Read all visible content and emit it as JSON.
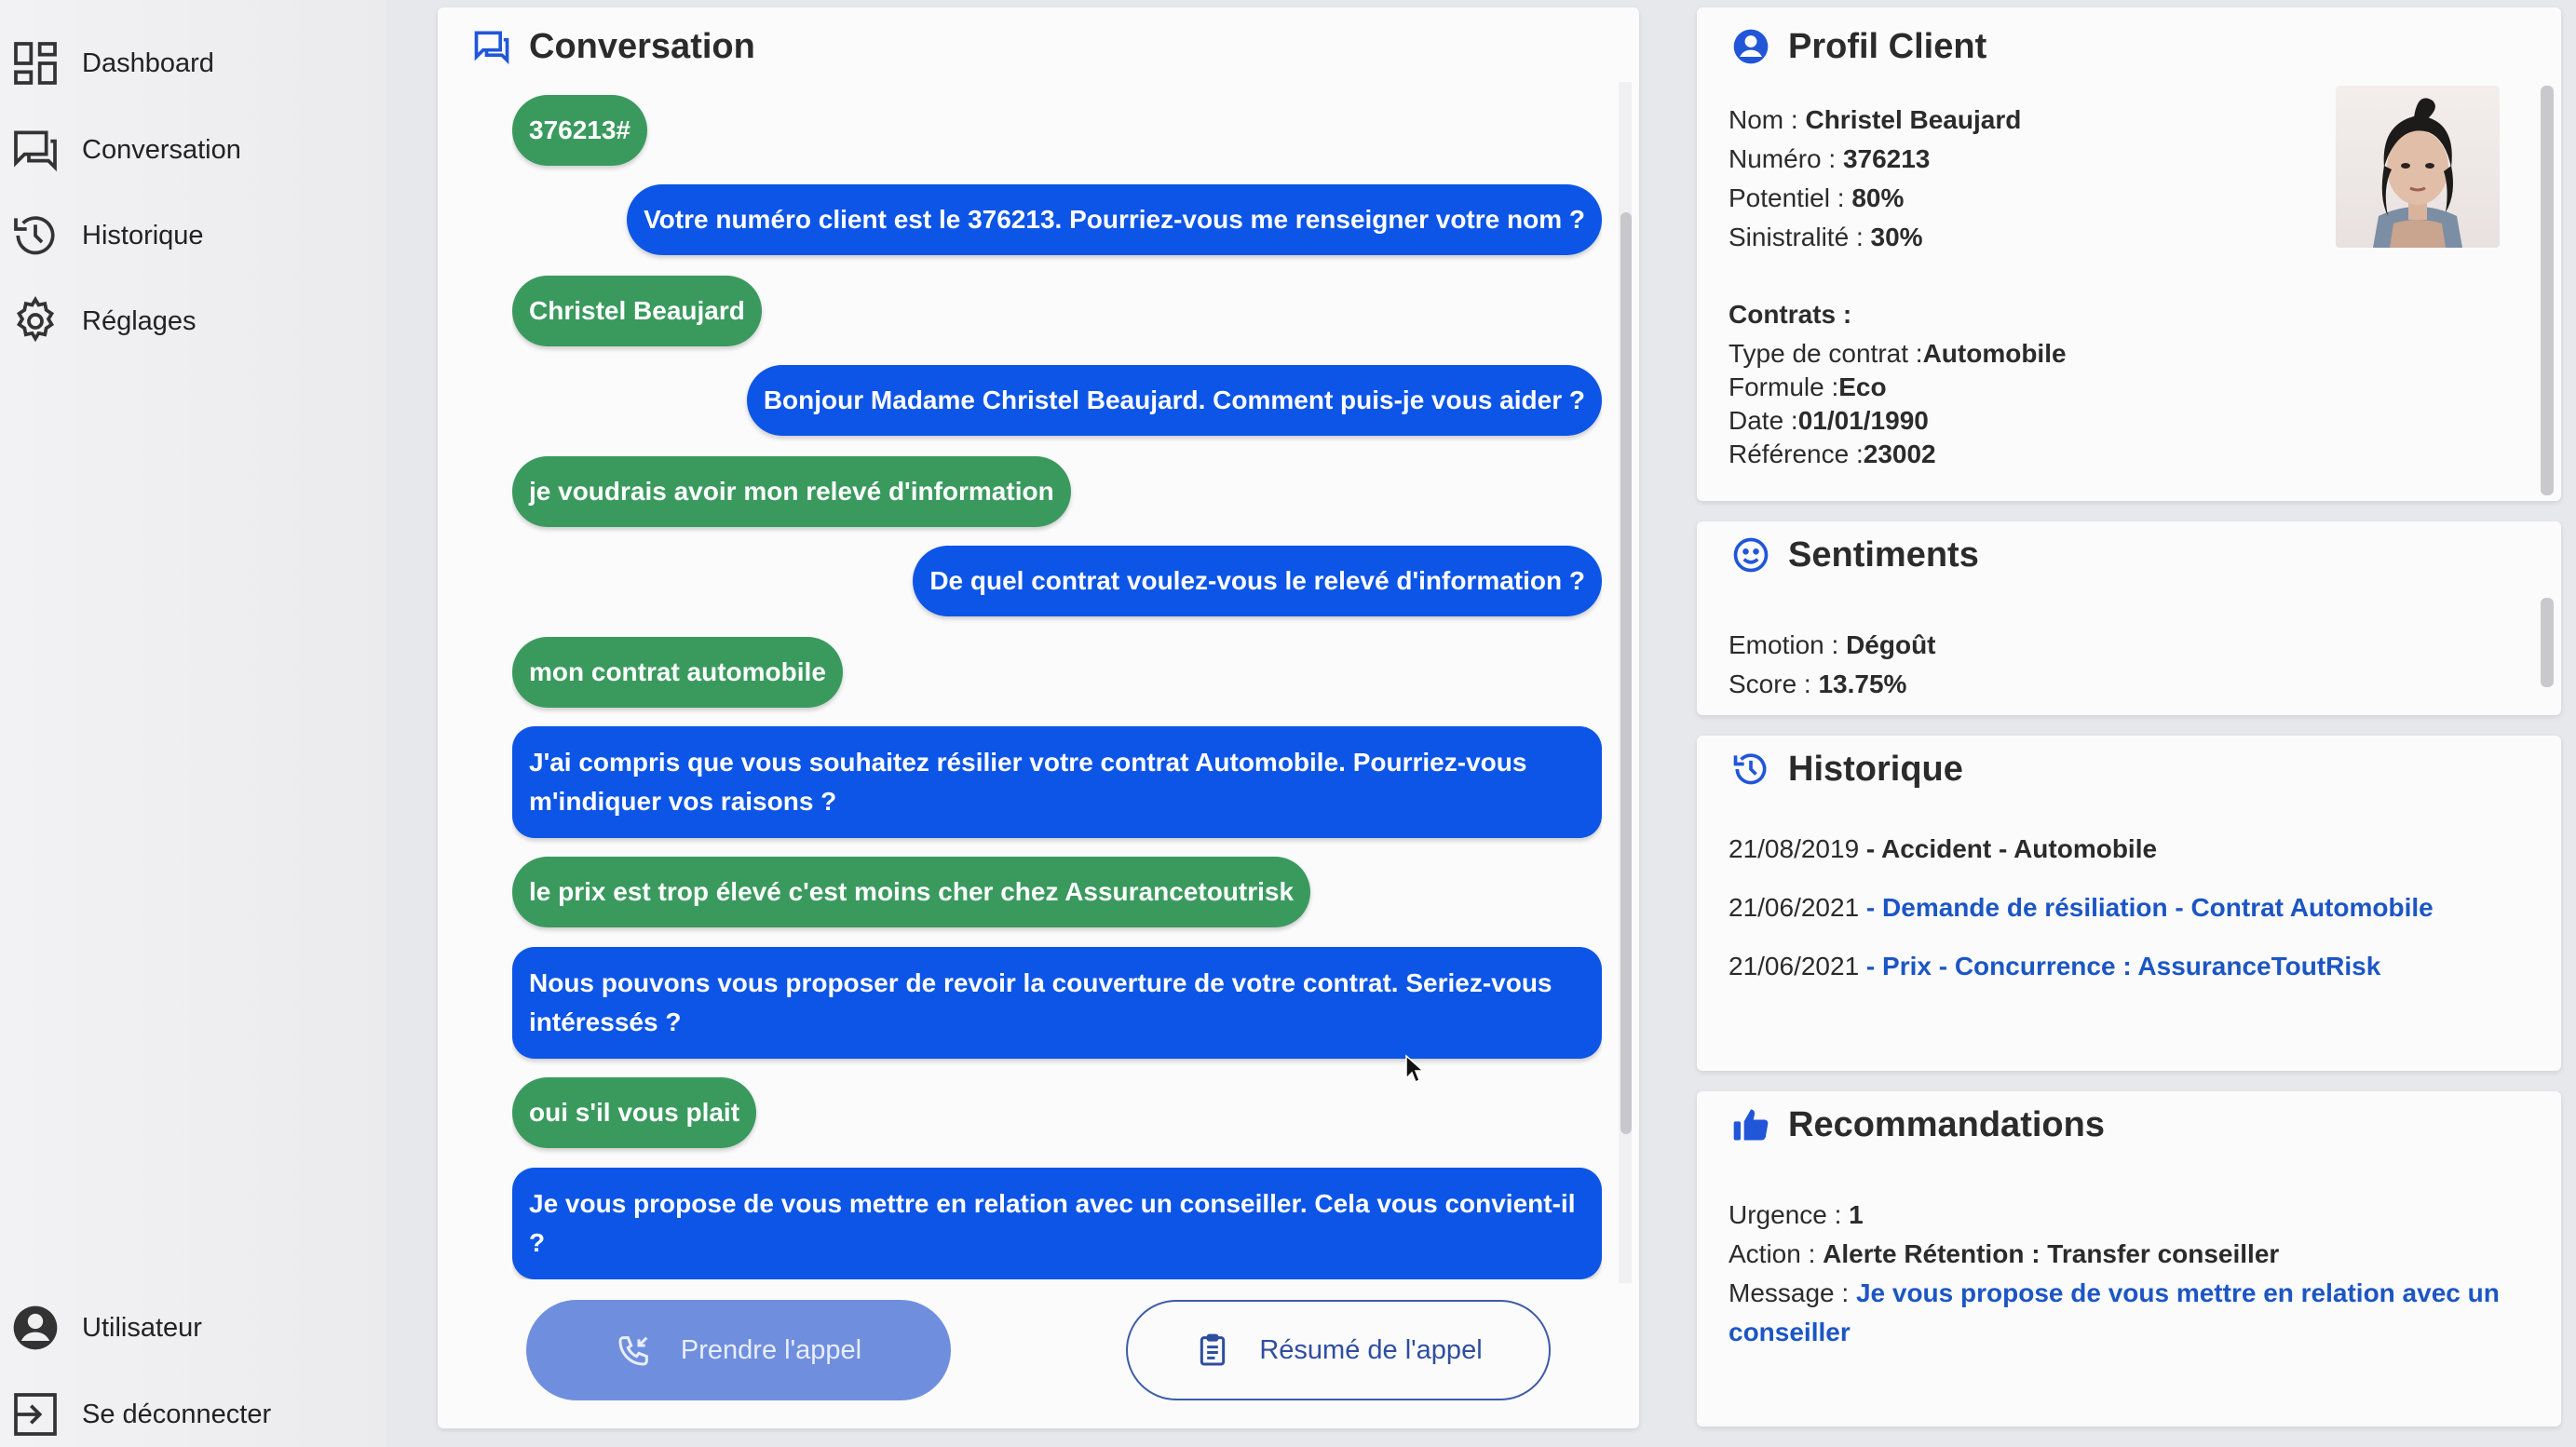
{
  "sidebar": {
    "items": [
      {
        "label": "Dashboard",
        "icon": "dashboard-icon"
      },
      {
        "label": "Conversation",
        "icon": "chat-icon"
      },
      {
        "label": "Historique",
        "icon": "history-icon"
      },
      {
        "label": "Réglages",
        "icon": "gear-icon"
      }
    ],
    "bottom": [
      {
        "label": "Utilisateur",
        "icon": "user-icon"
      },
      {
        "label": "Se déconnecter",
        "icon": "logout-icon"
      }
    ]
  },
  "conversation": {
    "title": "Conversation",
    "messages": [
      {
        "from": "client",
        "text": "376213#"
      },
      {
        "from": "agent",
        "text": "Votre numéro client est le 376213. Pourriez-vous me renseigner votre nom ?"
      },
      {
        "from": "client",
        "text": "Christel Beaujard"
      },
      {
        "from": "agent",
        "text": "Bonjour Madame Christel Beaujard. Comment puis-je vous aider ?"
      },
      {
        "from": "client",
        "text": "je voudrais avoir mon relevé d'information"
      },
      {
        "from": "agent",
        "text": "De quel contrat voulez-vous le relevé d'information ?"
      },
      {
        "from": "client",
        "text": "mon contrat automobile"
      },
      {
        "from": "agent",
        "text": "J'ai compris que vous souhaitez résilier votre contrat Automobile. Pourriez-vous m'indiquer vos raisons ?"
      },
      {
        "from": "client",
        "text": "le prix est trop élevé c'est moins cher chez Assurancetoutrisk"
      },
      {
        "from": "agent",
        "text": "Nous pouvons vous proposer de revoir la couverture de votre contrat. Seriez-vous intéressés ?"
      },
      {
        "from": "client",
        "text": "oui s'il vous plait"
      },
      {
        "from": "agent",
        "text": "Je vous propose de vous mettre en relation avec un conseiller. Cela vous convient-il ?"
      }
    ],
    "take_call_label": "Prendre l'appel",
    "summary_label": "Résumé de l'appel"
  },
  "profile": {
    "title": "Profil Client",
    "nom_label": "Nom : ",
    "nom": "Christel Beaujard",
    "numero_label": "Numéro : ",
    "numero": "376213",
    "potentiel_label": "Potentiel : ",
    "potentiel": "80%",
    "sinistralite_label": "Sinistralité : ",
    "sinistralite": "30%",
    "contrats_label": "Contrats :",
    "type_label": "Type de contrat :",
    "type": "Automobile",
    "formule_label": "Formule :",
    "formule": "Eco",
    "date_label": "Date :",
    "date": "01/01/1990",
    "reference_label": "Référence :",
    "reference": "23002"
  },
  "sentiments": {
    "title": "Sentiments",
    "emotion_label": "Emotion : ",
    "emotion": "Dégoût",
    "score_label": "Score : ",
    "score": "13.75%"
  },
  "historique": {
    "title": "Historique",
    "entries": [
      {
        "date": "21/08/2019",
        "sep": " - ",
        "text": "Accident - Automobile",
        "link": false
      },
      {
        "date": "21/06/2021",
        "sep": " - ",
        "text": "Demande de résiliation - Contrat Automobile",
        "link": true
      },
      {
        "date": "21/06/2021",
        "sep": " - ",
        "text": "Prix - Concurrence : AssuranceToutRisk",
        "link": true
      }
    ]
  },
  "recommandations": {
    "title": "Recommandations",
    "urgence_label": "Urgence : ",
    "urgence": "1",
    "action_label": "Action : ",
    "action": "Alerte Rétention : Transfer conseiller",
    "message_label": "Message : ",
    "message": "Je vous propose de vous mettre en relation avec un conseiller"
  }
}
